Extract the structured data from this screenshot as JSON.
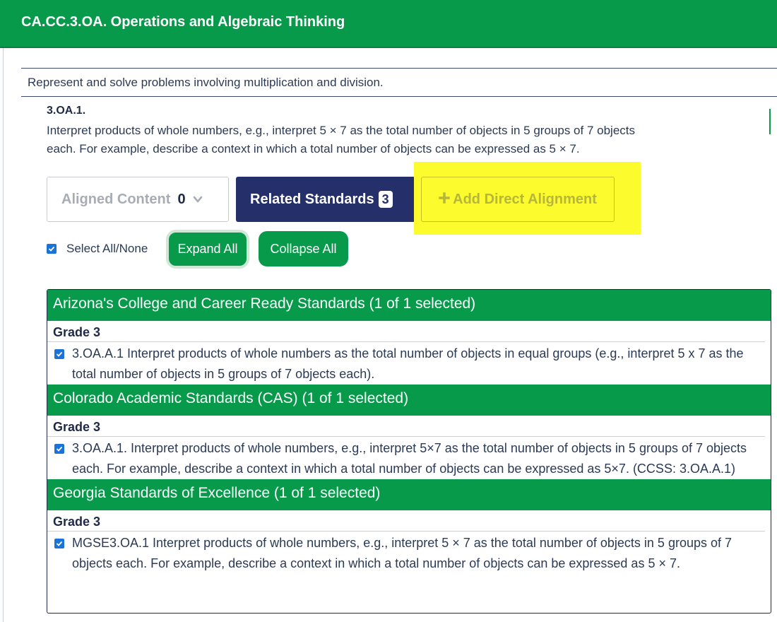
{
  "domain": {
    "title": "CA.CC.3.OA. Operations and Algebraic Thinking"
  },
  "cluster": {
    "text": "Represent and solve problems involving multiplication and division."
  },
  "standard": {
    "code": "3.OA.1.",
    "description": "Interpret products of whole numbers, e.g., interpret 5 × 7 as the total number of objects in 5 groups of 7 objects each. For example, describe a context in which a total number of objects can be expressed as 5 × 7."
  },
  "actions": {
    "aligned_label": "Aligned Content",
    "aligned_count": "0",
    "related_label": "Related Standards",
    "related_count": "3",
    "add_label": "Add Direct Alignment"
  },
  "controls": {
    "select_all_label": "Select All/None",
    "select_all_checked": true,
    "expand_label": "Expand All",
    "collapse_label": "Collapse All"
  },
  "groups": [
    {
      "header": "Arizona's College and Career Ready Standards (1 of 1 selected)",
      "grade": "Grade 3",
      "items": [
        {
          "checked": true,
          "text": "3.OA.A.1 Interpret products of whole numbers as the total number of objects in equal groups (e.g., interpret 5 x 7 as the total number of objects in 5 groups of 7 objects each)."
        }
      ]
    },
    {
      "header": "Colorado Academic Standards (CAS) (1 of 1 selected)",
      "grade": "Grade 3",
      "items": [
        {
          "checked": true,
          "text": "3.OA.A.1. Interpret products of whole numbers, e.g., interpret 5×7 as the total number of objects in 5 groups of 7 objects each. For example, describe a context in which a total number of objects can be expressed as 5×7. (CCSS: 3.OA.A.1)"
        }
      ]
    },
    {
      "header": "Georgia Standards of Excellence (1 of 1 selected)",
      "grade": "Grade 3",
      "items": [
        {
          "checked": true,
          "text": "MGSE3.OA.1 Interpret products of whole numbers, e.g., interpret 5 × 7 as the total number of objects in 5 groups of 7 objects each. For example, describe a context in which a total number of objects can be expressed as 5 × 7."
        }
      ]
    }
  ],
  "colors": {
    "green": "#079a4a",
    "navy": "#25306b",
    "highlight_yellow": "#fbfb2e",
    "checkbox_blue": "#1a73d8"
  },
  "icons": [
    "chevron-down-icon",
    "plus-icon",
    "checkmark-icon"
  ]
}
